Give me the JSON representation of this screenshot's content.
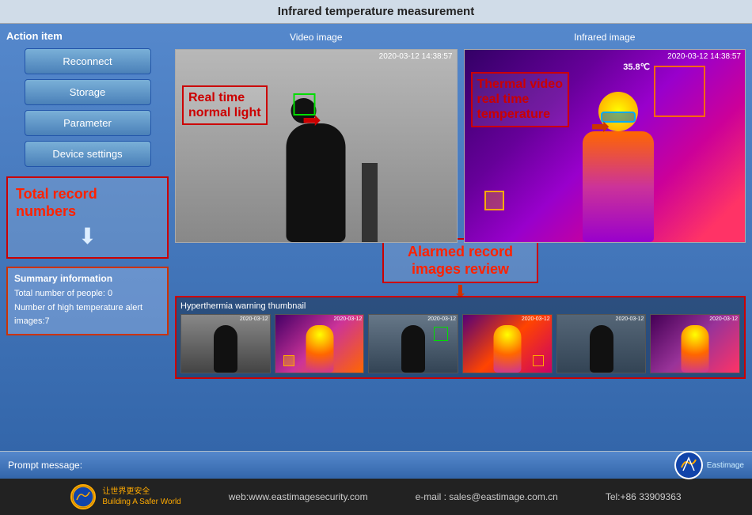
{
  "title": "Infrared temperature measurement",
  "left_panel": {
    "action_label": "Action item",
    "buttons": [
      {
        "label": "Reconnect",
        "name": "reconnect-button"
      },
      {
        "label": "Storage",
        "name": "storage-button"
      },
      {
        "label": "Parameter",
        "name": "parameter-button"
      },
      {
        "label": "Device settings",
        "name": "device-settings-button"
      }
    ],
    "record_label": "Total record numbers",
    "summary": {
      "title": "Summary information",
      "total_people": "Total number of people:  0",
      "alert_images": "Number of high temperature alert images:7"
    }
  },
  "right_panel": {
    "video_label": "Video image",
    "infrared_label": "Infrared image",
    "timestamp1": "2020-03-12 14:38:57",
    "timestamp2": "2020-03-12 14:38:57",
    "real_time_label_line1": "Real time",
    "real_time_label_line2": "normal light",
    "thermal_label_line1": "Thermal video",
    "thermal_label_line2": "real time",
    "thermal_label_line3": "temperature",
    "temp_value": "35.8℃",
    "alarmed_line1": "Alarmed record",
    "alarmed_line2": "images review",
    "thumbnail_label": "Hyperthermia warning thumbnail",
    "thumbnails": [
      {
        "ts": "2020-03-12",
        "type": "dark"
      },
      {
        "ts": "2020-03-12",
        "type": "thermal"
      },
      {
        "ts": "2020-03-12",
        "type": "dark"
      },
      {
        "ts": "2020-03-12",
        "type": "thermal"
      },
      {
        "ts": "2020-03-12",
        "type": "dark"
      },
      {
        "ts": "2020-03-12",
        "type": "thermal"
      }
    ]
  },
  "prompt": {
    "label": "Prompt message:"
  },
  "footer": {
    "web": "web:www.eastimagesecurity.com",
    "email": "e-mail : sales@eastimage.com.cn",
    "tel": "Tel:+86 33909363",
    "logo_text_line1": "让世界更安全",
    "logo_text_line2": "Building A Safer World"
  }
}
